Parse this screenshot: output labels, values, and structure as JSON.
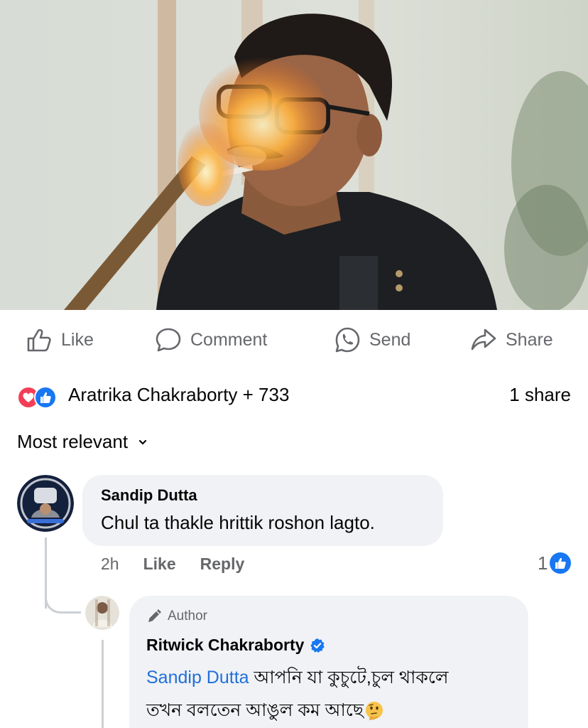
{
  "actions": {
    "like": "Like",
    "comment": "Comment",
    "send": "Send",
    "share": "Share"
  },
  "reactions": {
    "text": "Aratrika Chakraborty + 733",
    "shares": "1 share"
  },
  "sort": {
    "label": "Most relevant"
  },
  "comments": [
    {
      "author": "Sandip Dutta",
      "text": "Chul ta thakle hrittik roshon lagto.",
      "time": "2h",
      "like_label": "Like",
      "reply_label": "Reply",
      "like_count": "1",
      "replies": [
        {
          "badge": "Author",
          "author": "Ritwick Chakraborty",
          "verified": true,
          "mention": "Sandip Dutta",
          "text_line1": "আপনি যা কুচুটে,চুল থাকলে",
          "text_line2": "তখন বলতেন আঙুল কম আছে",
          "emoji": "thinking-face"
        }
      ]
    }
  ],
  "colors": {
    "text_primary": "#050505",
    "text_secondary": "#65676b",
    "bubble": "#f0f2f5",
    "link_blue": "#216fdb",
    "like_blue": "#1877f2",
    "love_red": "#f33e58"
  }
}
